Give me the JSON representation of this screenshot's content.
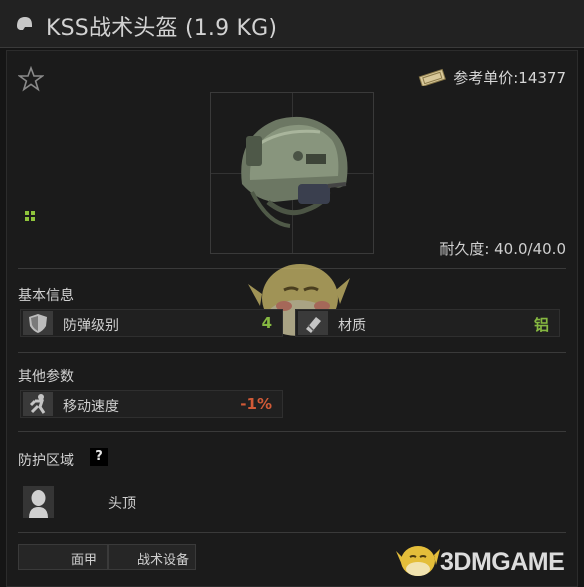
{
  "title": "KSS战术头盔 (1.9 KG)",
  "price": {
    "label": "参考单价:14377"
  },
  "durability": {
    "label": "耐久度: 40.0/40.0"
  },
  "basic_info": {
    "heading": "基本信息",
    "armor_class": {
      "label": "防弹级别",
      "value": "4"
    },
    "material": {
      "label": "材质",
      "value": "铝"
    }
  },
  "other_params": {
    "heading": "其他参数",
    "move_speed": {
      "label": "移动速度",
      "value": "-1%"
    }
  },
  "protection": {
    "heading": "防护区域",
    "help": "?",
    "zone": "头顶"
  },
  "tabs": [
    "面甲",
    "战术设备"
  ],
  "watermark": "3DMGAME",
  "colors": {
    "positive": "#86b841",
    "negative": "#d05a37",
    "background": "#151515"
  },
  "icons": [
    "helmet-icon",
    "star-icon",
    "price-tag-icon",
    "grid-icon",
    "shield-icon",
    "material-icon",
    "running-icon",
    "head-silhouette-icon"
  ]
}
